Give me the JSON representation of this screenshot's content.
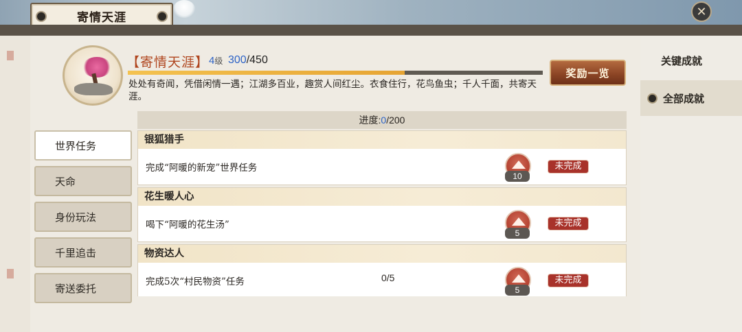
{
  "window": {
    "title": "寄情天涯"
  },
  "close_icon": "close-icon",
  "header": {
    "title": "【寄情天涯】",
    "level_num": "4",
    "level_unit": "级",
    "score_current": "300",
    "score_total": "/450",
    "exp_fraction": 0.667,
    "description": "处处有奇闻，凭借闲情一遇；江湖多百业，趣赏人间红尘。衣食住行，花鸟鱼虫；千人千面，共寄天涯。",
    "reward_button": "奖励一览"
  },
  "side_nav": [
    {
      "label": "关键成就",
      "active": false
    },
    {
      "label": "全部成就",
      "active": true
    }
  ],
  "tabs": [
    {
      "label": "世界任务",
      "active": true
    },
    {
      "label": "天命",
      "active": false
    },
    {
      "label": "身份玩法",
      "active": false
    },
    {
      "label": "千里追击",
      "active": false
    },
    {
      "label": "寄送委托",
      "active": false
    }
  ],
  "progress": {
    "label": "进度:",
    "current": "0",
    "total": "/200"
  },
  "achievements": [
    {
      "name": "银狐猎手",
      "desc": "完成“阿暖的新宠”世界任务",
      "progress": "",
      "points": "10",
      "status": "未完成"
    },
    {
      "name": "花生暖人心",
      "desc": "喝下“阿暖的花生汤”",
      "progress": "",
      "points": "5",
      "status": "未完成"
    },
    {
      "name": "物资达人",
      "desc": "完成5次“村民物资”任务",
      "progress": "0/5",
      "points": "5",
      "status": "未完成"
    }
  ]
}
